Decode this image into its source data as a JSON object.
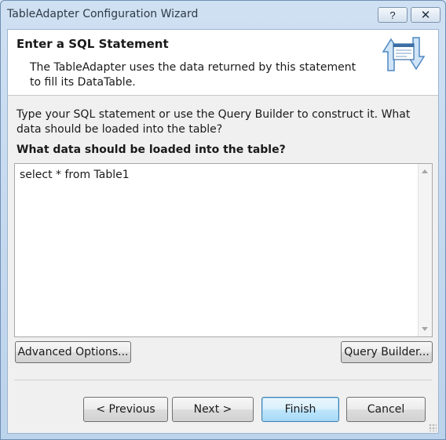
{
  "window": {
    "title": "TableAdapter Configuration Wizard",
    "help_label": "?",
    "close_label": "✕"
  },
  "header": {
    "title": "Enter a SQL Statement",
    "description": "The TableAdapter uses the data returned by this statement to fill its DataTable.",
    "icon": "table-adapter-sync-icon"
  },
  "body": {
    "intro": "Type your SQL statement or use the Query Builder to construct it. What data should be loaded into the table?",
    "question": "What data should be loaded into the table?",
    "sql_value": "select * from Table1"
  },
  "buttons": {
    "advanced_options": "Advanced Options...",
    "query_builder": "Query Builder...",
    "previous": "< Previous",
    "next": "Next >",
    "finish": "Finish",
    "cancel": "Cancel"
  },
  "colors": {
    "accent": "#3c7fb1",
    "window_frame": "#bcd3ec",
    "client_bg": "#f0f0f0"
  }
}
